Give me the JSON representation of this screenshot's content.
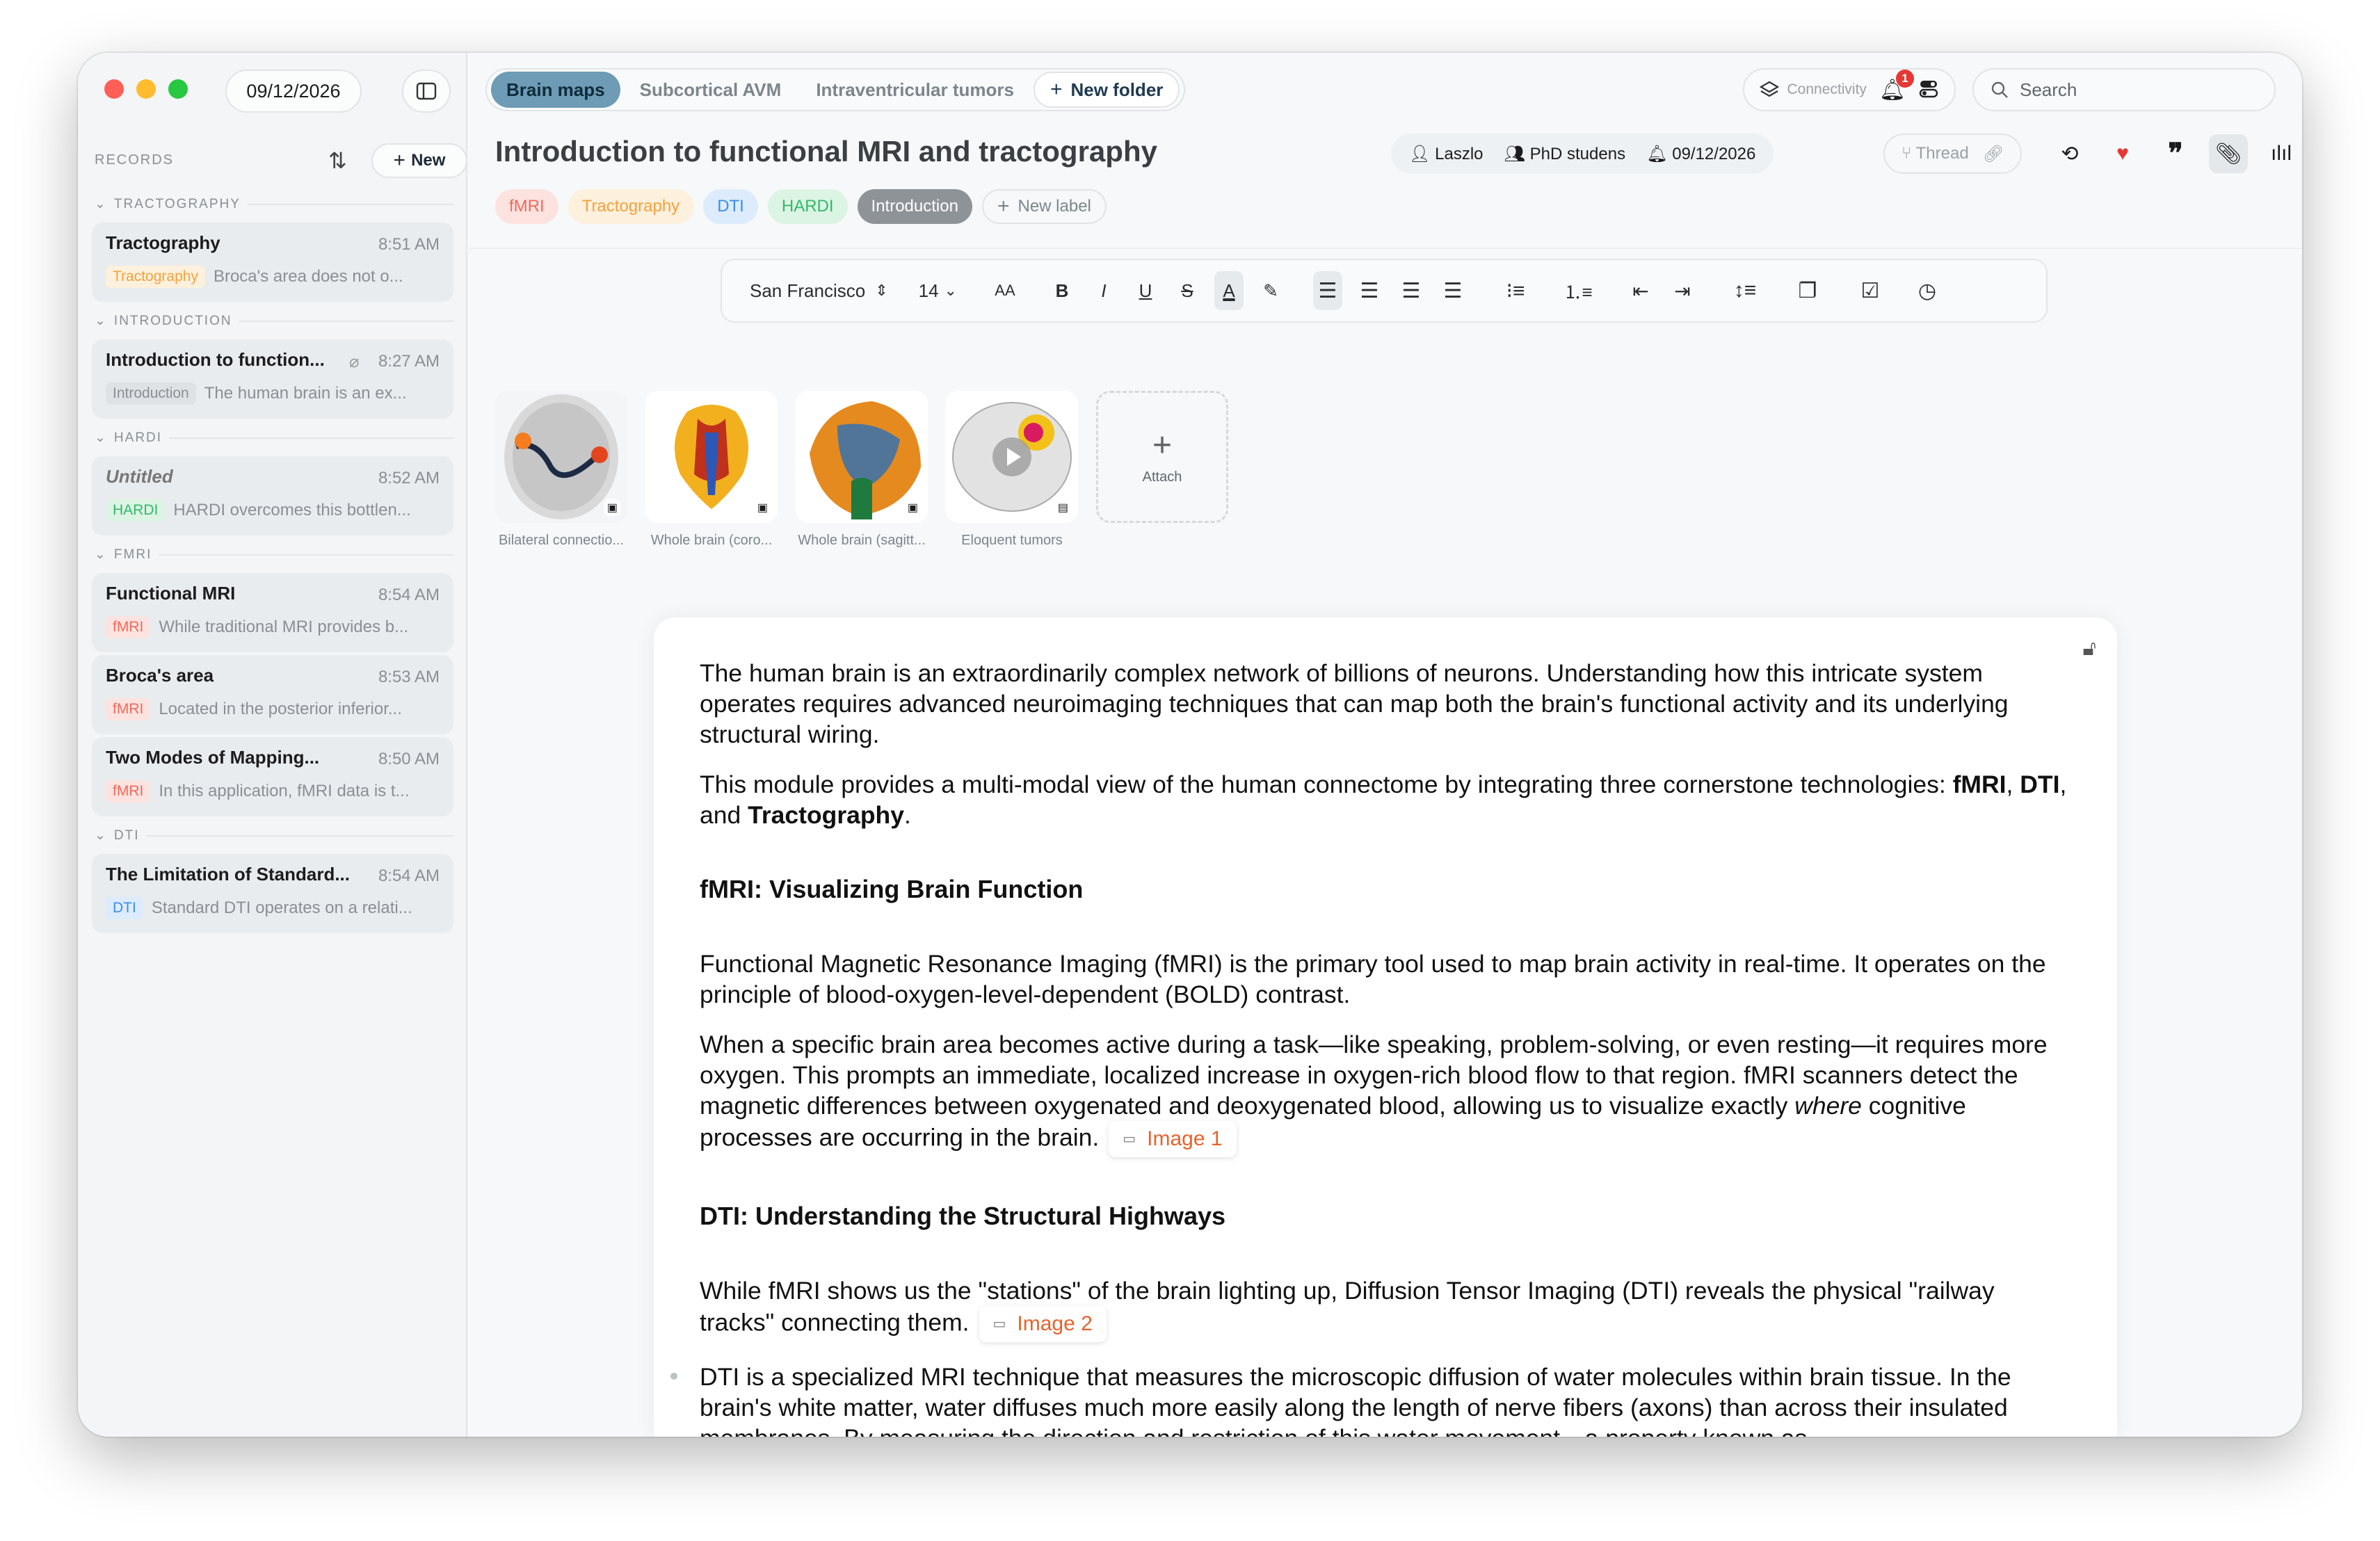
{
  "sidebar": {
    "date": "09/12/2026",
    "records_title": "RECORDS",
    "new_label": "New",
    "groups": {
      "tractography": "TRACTOGRAPHY",
      "introduction": "INTRODUCTION",
      "hardi": "HARDI",
      "fmri": "FMRI",
      "dti": "DTI"
    },
    "notes": [
      {
        "title": "Tractography",
        "time": "8:51 AM",
        "tag": "Tractography",
        "preview": "Broca's area does not o..."
      },
      {
        "title": "Introduction to function...",
        "time": "8:27 AM",
        "tag": "Introduction",
        "preview": "The human brain is an ex..."
      },
      {
        "title": "Untitled",
        "time": "8:52 AM",
        "tag": "HARDI",
        "preview": "HARDI overcomes this bottlen..."
      },
      {
        "title": "Functional MRI",
        "time": "8:54 AM",
        "tag": "fMRI",
        "preview": "While traditional MRI provides b..."
      },
      {
        "title": "Broca's area",
        "time": "8:53 AM",
        "tag": "fMRI",
        "preview": "Located in the posterior inferior..."
      },
      {
        "title": "Two Modes of Mapping...",
        "time": "8:50 AM",
        "tag": "fMRI",
        "preview": "In this application, fMRI data is t..."
      },
      {
        "title": "The Limitation of Standard...",
        "time": "8:54 AM",
        "tag": "DTI",
        "preview": "Standard DTI operates on a relati..."
      }
    ]
  },
  "tabs": [
    "Brain maps",
    "Subcortical AVM",
    "Intraventricular tumors"
  ],
  "new_folder": "New folder",
  "connectivity": "Connectivity",
  "notification_count": "1",
  "search_placeholder": "Search",
  "doc": {
    "title": "Introduction to functional MRI and tractography",
    "owner": "Laszlo",
    "group": "PhD studens",
    "date": "09/12/2026",
    "thread": "Thread",
    "labels": [
      "fMRI",
      "Tractography",
      "DTI",
      "HARDI",
      "Introduction"
    ],
    "new_label": "New label"
  },
  "toolbar": {
    "font": "San Francisco",
    "size": "14",
    "case": "AA",
    "bold": "B",
    "italic": "I",
    "underline": "U",
    "strike": "S",
    "color": "A"
  },
  "attachments": [
    {
      "caption": "Bilateral connectio..."
    },
    {
      "caption": "Whole brain (coro..."
    },
    {
      "caption": "Whole brain (sagitt..."
    },
    {
      "caption": "Eloquent tumors"
    }
  ],
  "attach_label": "Attach",
  "content": {
    "p1": "The human brain is an extraordinarily complex network of billions of neurons. Understanding how this intricate system operates requires advanced neuroimaging techniques that can map both the brain's functional activity and its underlying structural wiring.",
    "p2_a": "This module provides a multi-modal view of the human connectome by integrating three cornerstone technologies: ",
    "p2_fmri": "fMRI",
    "p2_sep1": ", ",
    "p2_dti": "DTI",
    "p2_sep2": ", and ",
    "p2_tract": "Tractography",
    "p2_end": ".",
    "h1": "fMRI: Visualizing Brain Function",
    "p3": "Functional Magnetic Resonance Imaging (fMRI) is the primary tool used to map brain activity in real-time. It operates on the principle of blood-oxygen-level-dependent (BOLD) contrast.",
    "p4_a": "When a specific brain area becomes active during a task—like speaking, problem-solving, or even resting—it requires more oxygen. This prompts an immediate, localized increase in oxygen-rich blood flow to that region. fMRI scanners detect the magnetic differences between oxygenated and deoxygenated blood, allowing us to visualize exactly ",
    "p4_where": "where",
    "p4_b": " cognitive processes are occurring in the brain.",
    "image1": "Image 1",
    "h2": "DTI: Understanding the Structural Highways",
    "p5": "While fMRI shows us the \"stations\" of the brain lighting up, Diffusion Tensor Imaging (DTI) reveals the physical \"railway tracks\" connecting them.",
    "image2": "Image 2",
    "p6": "DTI is a specialized MRI technique that measures the microscopic diffusion of water molecules within brain tissue. In the brain's white matter, water diffuses much more easily along the length of nerve fibers (axons) than across their insulated membranes. By measuring the direction and restriction of this water movement—a property known as"
  },
  "colors": {
    "accent": "#6e9bb5",
    "fmri": "#f2685a",
    "tract": "#f4a23c",
    "dti": "#3c8ee8",
    "hardi": "#34b86a",
    "intro": "#8e9398",
    "link": "#e8622c"
  }
}
